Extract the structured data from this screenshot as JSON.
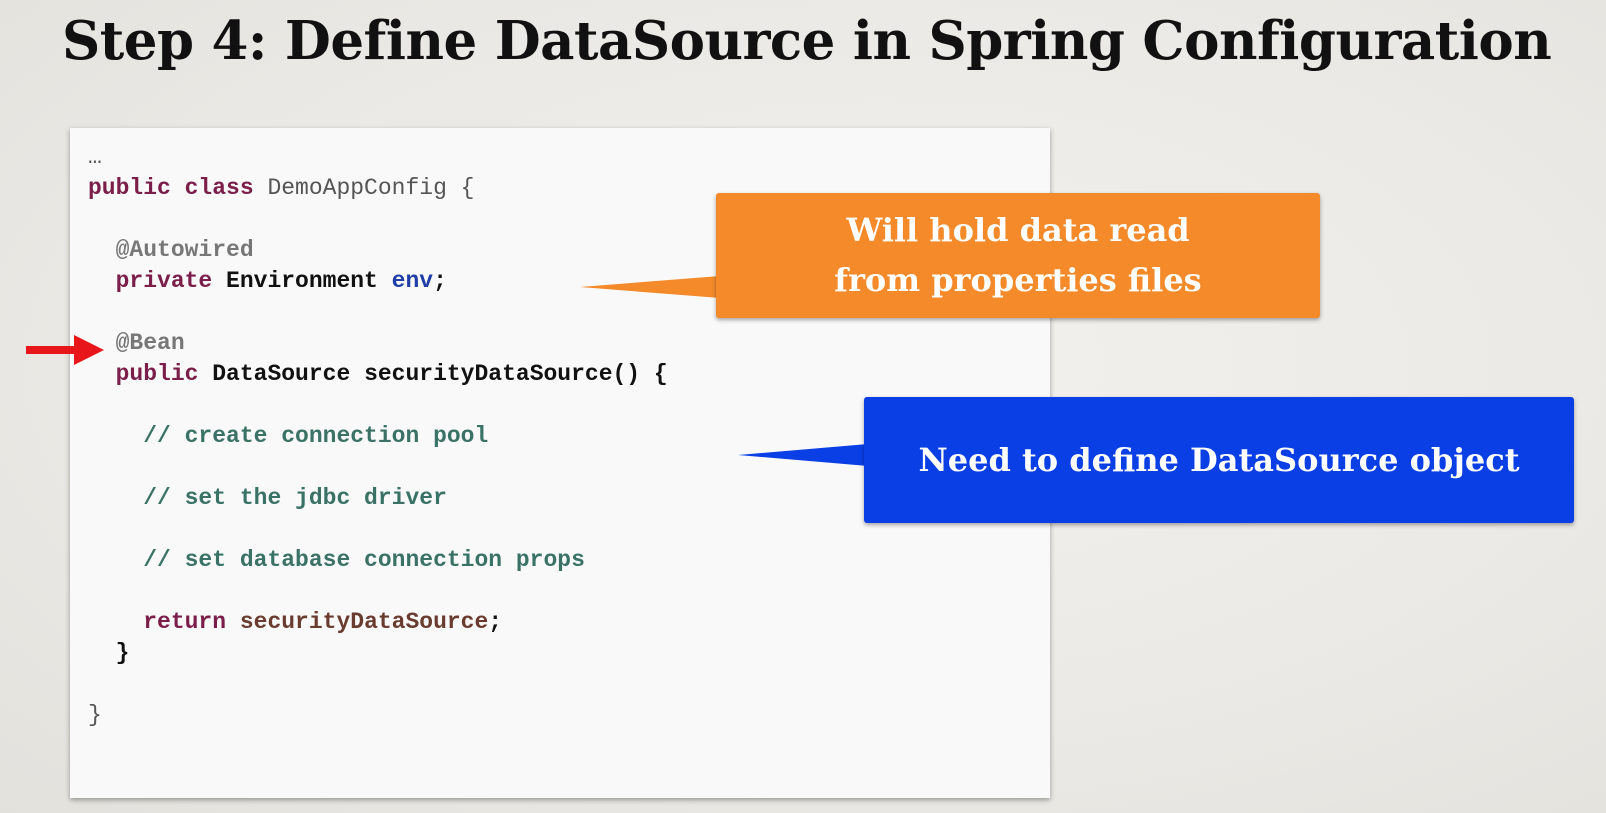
{
  "slide": {
    "title": "Step 4:  Define DataSource in Spring Configuration"
  },
  "code": {
    "lines": [
      [
        {
          "t": "…",
          "c": "plain"
        }
      ],
      [
        {
          "t": "public class",
          "c": "kw"
        },
        {
          "t": " DemoAppConfig {",
          "c": "plain"
        }
      ],
      [],
      [
        {
          "t": "  ",
          "c": "plain"
        },
        {
          "t": "@Autowired",
          "c": "ann"
        }
      ],
      [
        {
          "t": "  ",
          "c": "plain"
        },
        {
          "t": "private",
          "c": "kw"
        },
        {
          "t": " Environment ",
          "c": "type"
        },
        {
          "t": "env",
          "c": "field"
        },
        {
          "t": ";",
          "c": "plain-bold"
        }
      ],
      [],
      [
        {
          "t": "  ",
          "c": "plain"
        },
        {
          "t": "@Bean",
          "c": "ann"
        }
      ],
      [
        {
          "t": "  ",
          "c": "plain"
        },
        {
          "t": "public",
          "c": "kw"
        },
        {
          "t": " DataSource securityDataSource() {",
          "c": "type"
        }
      ],
      [],
      [
        {
          "t": "    ",
          "c": "plain"
        },
        {
          "t": "// create connection pool",
          "c": "comment"
        }
      ],
      [],
      [
        {
          "t": "    ",
          "c": "plain"
        },
        {
          "t": "// set the jdbc driver",
          "c": "comment"
        }
      ],
      [],
      [
        {
          "t": "    ",
          "c": "plain"
        },
        {
          "t": "// set database connection props",
          "c": "comment"
        }
      ],
      [],
      [
        {
          "t": "    ",
          "c": "plain"
        },
        {
          "t": "return",
          "c": "kw"
        },
        {
          "t": " securityDataSource",
          "c": "var"
        },
        {
          "t": ";",
          "c": "plain-bold"
        }
      ],
      [
        {
          "t": "  }",
          "c": "plain-bold"
        }
      ],
      [],
      [
        {
          "t": "}",
          "c": "plain"
        }
      ]
    ]
  },
  "callouts": {
    "orange": {
      "line1": "Will hold data read",
      "line2": "from properties files",
      "color": "#f48a2a"
    },
    "blue": {
      "text": "Need to define DataSource object",
      "color": "#0a3fe6"
    }
  },
  "markers": {
    "arrow_icon": "right-arrow-icon",
    "arrow_color": "#e8161a"
  }
}
